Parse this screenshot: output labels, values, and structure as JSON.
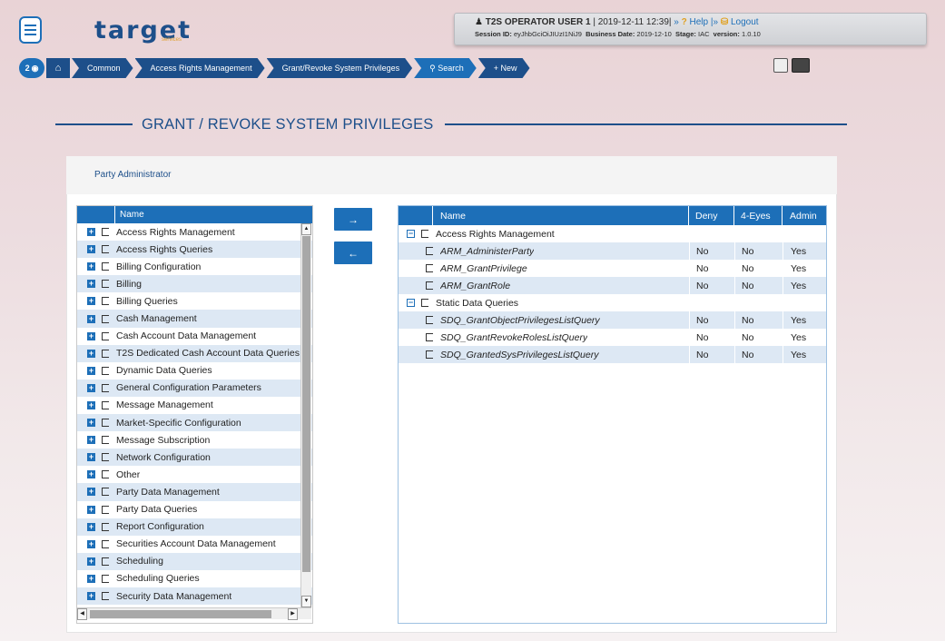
{
  "header": {
    "logo": "target",
    "logo_sub": "services",
    "user": "T2S OPERATOR USER 1",
    "datetime": "| 2019-12-11 12:39|",
    "help_label": "Help",
    "logout_label": "Logout",
    "session_label": "Session ID:",
    "session_value": "eyJhbGciOiJIUzI1NiJ9",
    "business_date_label": "Business Date:",
    "business_date_value": "2019-12-10",
    "stage_label": "Stage:",
    "stage_value": "IAC",
    "version_label": "version:",
    "version_value": "1.0.10"
  },
  "breadcrumb": {
    "badge_count": "2",
    "items": [
      "Common",
      "Access Rights Management",
      "Grant/Revoke System Privileges",
      "Search",
      "New"
    ]
  },
  "page": {
    "title": "GRANT / REVOKE SYSTEM PRIVILEGES",
    "party_label": "Party Administrator"
  },
  "left_table": {
    "header": "Name",
    "rows": [
      "Access Rights Management",
      "Access Rights Queries",
      "Billing Configuration",
      "Billing",
      "Billing Queries",
      "Cash Management",
      "Cash Account Data Management",
      "T2S Dedicated Cash Account Data Queries",
      "Dynamic Data Queries",
      "General Configuration Parameters",
      "Message Management",
      "Market-Specific Configuration",
      "Message Subscription",
      "Network Configuration",
      "Other",
      "Party Data Management",
      "Party Data Queries",
      "Report Configuration",
      "Securities Account Data Management",
      "Scheduling",
      "Scheduling Queries",
      "Security Data Management"
    ]
  },
  "buttons": {
    "move_right": "→",
    "move_left": "←"
  },
  "right_table": {
    "headers": {
      "name": "Name",
      "deny": "Deny",
      "four_eyes": "4-Eyes",
      "admin": "Admin"
    },
    "rows": [
      {
        "name": "Access Rights Management",
        "group": true,
        "deny": "",
        "four_eyes": "",
        "admin": ""
      },
      {
        "name": "ARM_AdministerParty",
        "group": false,
        "deny": "No",
        "four_eyes": "No",
        "admin": "Yes"
      },
      {
        "name": "ARM_GrantPrivilege",
        "group": false,
        "deny": "No",
        "four_eyes": "No",
        "admin": "Yes"
      },
      {
        "name": "ARM_GrantRole",
        "group": false,
        "deny": "No",
        "four_eyes": "No",
        "admin": "Yes"
      },
      {
        "name": "Static Data Queries",
        "group": true,
        "deny": "",
        "four_eyes": "",
        "admin": ""
      },
      {
        "name": "SDQ_GrantObjectPrivilegesListQuery",
        "group": false,
        "deny": "No",
        "four_eyes": "No",
        "admin": "Yes"
      },
      {
        "name": "SDQ_GrantRevokeRolesListQuery",
        "group": false,
        "deny": "No",
        "four_eyes": "No",
        "admin": "Yes"
      },
      {
        "name": "SDQ_GrantedSysPrivilegesListQuery",
        "group": false,
        "deny": "No",
        "four_eyes": "No",
        "admin": "Yes"
      }
    ]
  },
  "icons": [
    "menu-icon",
    "eye-icon",
    "home-icon",
    "search-icon",
    "plus-icon",
    "save-icon",
    "print-icon",
    "user-icon",
    "help-icon",
    "lock-icon",
    "expand-icon",
    "collapse-icon",
    "checkbox-icon"
  ]
}
